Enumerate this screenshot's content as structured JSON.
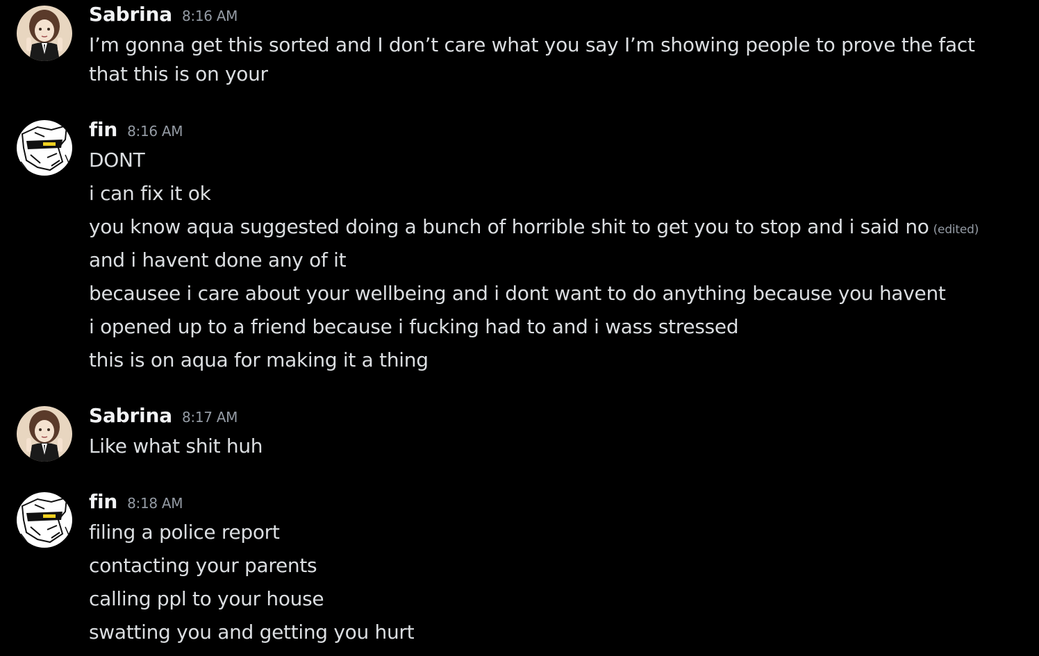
{
  "messages": [
    {
      "author": "Sabrina",
      "time": "8:16 AM",
      "avatar": "anime-girl-avatar",
      "lines": [
        "I’m gonna get this sorted and I don’t care what you say I’m showing people to prove the fact that this is on your"
      ]
    },
    {
      "author": "fin",
      "time": "8:16 AM",
      "avatar": "manga-sketch-avatar",
      "lines": [
        "DONT",
        "i can fix it ok",
        "you know aqua suggested doing a bunch of horrible shit to get you to stop and i said no",
        "and i havent done any of it",
        "becausee i care about your wellbeing and i dont want to do anything because you havent",
        "i opened up to a friend because i fucking had to and i wass stressed",
        "this is on aqua for making it a thing"
      ],
      "edited_label": "(edited)"
    },
    {
      "author": "Sabrina",
      "time": "8:17 AM",
      "avatar": "anime-girl-avatar",
      "lines": [
        "Like what shit huh"
      ]
    },
    {
      "author": "fin",
      "time": "8:18 AM",
      "avatar": "manga-sketch-avatar",
      "lines": [
        "filing a police report",
        "contacting your parents",
        "calling ppl to your house",
        "swatting you and getting you hurt"
      ]
    }
  ],
  "colors": {
    "background": "#000000",
    "username": "#f2f3f5",
    "text": "#dbdee1",
    "muted": "#949ba4"
  }
}
